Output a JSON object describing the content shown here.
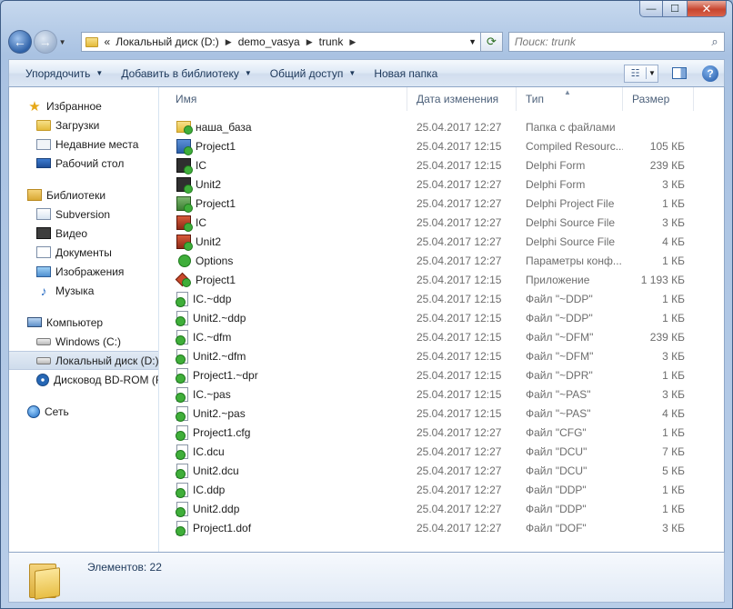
{
  "window": {
    "caption_min": "—",
    "caption_max": "☐",
    "caption_close": "✕"
  },
  "address": {
    "overflow": "«",
    "segments": [
      "Локальный диск (D:)",
      "demo_vasya",
      "trunk"
    ]
  },
  "search": {
    "placeholder": "Поиск: trunk"
  },
  "toolbar": {
    "organize": "Упорядочить",
    "add_library": "Добавить в библиотеку",
    "share": "Общий доступ",
    "new_folder": "Новая папка"
  },
  "nav": {
    "favorites": {
      "label": "Избранное",
      "items": [
        "Загрузки",
        "Недавние места",
        "Рабочий стол"
      ]
    },
    "libraries": {
      "label": "Библиотеки",
      "items": [
        "Subversion",
        "Видео",
        "Документы",
        "Изображения",
        "Музыка"
      ]
    },
    "computer": {
      "label": "Компьютер",
      "items": [
        "Windows (C:)",
        "Локальный диск (D:)",
        "Дисковод BD-ROM (F"
      ]
    },
    "network": {
      "label": "Сеть"
    }
  },
  "columns": {
    "name": "Имя",
    "date": "Дата изменения",
    "type": "Тип",
    "size": "Размер"
  },
  "files": [
    {
      "name": "наша_база",
      "date": "25.04.2017 12:27",
      "type": "Папка с файлами",
      "size": "",
      "icon": "folder-icon"
    },
    {
      "name": "Project1",
      "date": "25.04.2017 12:15",
      "type": "Compiled Resourc...",
      "size": "105 КБ",
      "icon": "resource-file-icon"
    },
    {
      "name": "IC",
      "date": "25.04.2017 12:15",
      "type": "Delphi Form",
      "size": "239 КБ",
      "icon": "delphi-form-icon"
    },
    {
      "name": "Unit2",
      "date": "25.04.2017 12:27",
      "type": "Delphi Form",
      "size": "3 КБ",
      "icon": "delphi-form-icon"
    },
    {
      "name": "Project1",
      "date": "25.04.2017 12:27",
      "type": "Delphi Project File",
      "size": "1 КБ",
      "icon": "delphi-project-icon"
    },
    {
      "name": "IC",
      "date": "25.04.2017 12:27",
      "type": "Delphi Source File",
      "size": "3 КБ",
      "icon": "delphi-source-icon"
    },
    {
      "name": "Unit2",
      "date": "25.04.2017 12:27",
      "type": "Delphi Source File",
      "size": "4 КБ",
      "icon": "delphi-source-icon"
    },
    {
      "name": "Options",
      "date": "25.04.2017 12:27",
      "type": "Параметры конф...",
      "size": "1 КБ",
      "icon": "options-file-icon"
    },
    {
      "name": "Project1",
      "date": "25.04.2017 12:15",
      "type": "Приложение",
      "size": "1 193 КБ",
      "icon": "application-icon"
    },
    {
      "name": "IC.~ddp",
      "date": "25.04.2017 12:15",
      "type": "Файл \"~DDP\"",
      "size": "1 КБ",
      "icon": "file-icon"
    },
    {
      "name": "Unit2.~ddp",
      "date": "25.04.2017 12:15",
      "type": "Файл \"~DDP\"",
      "size": "1 КБ",
      "icon": "file-icon"
    },
    {
      "name": "IC.~dfm",
      "date": "25.04.2017 12:15",
      "type": "Файл \"~DFM\"",
      "size": "239 КБ",
      "icon": "file-icon"
    },
    {
      "name": "Unit2.~dfm",
      "date": "25.04.2017 12:15",
      "type": "Файл \"~DFM\"",
      "size": "3 КБ",
      "icon": "file-icon"
    },
    {
      "name": "Project1.~dpr",
      "date": "25.04.2017 12:15",
      "type": "Файл \"~DPR\"",
      "size": "1 КБ",
      "icon": "file-icon"
    },
    {
      "name": "IC.~pas",
      "date": "25.04.2017 12:15",
      "type": "Файл \"~PAS\"",
      "size": "3 КБ",
      "icon": "file-icon"
    },
    {
      "name": "Unit2.~pas",
      "date": "25.04.2017 12:15",
      "type": "Файл \"~PAS\"",
      "size": "4 КБ",
      "icon": "file-icon"
    },
    {
      "name": "Project1.cfg",
      "date": "25.04.2017 12:27",
      "type": "Файл \"CFG\"",
      "size": "1 КБ",
      "icon": "file-icon"
    },
    {
      "name": "IC.dcu",
      "date": "25.04.2017 12:27",
      "type": "Файл \"DCU\"",
      "size": "7 КБ",
      "icon": "file-icon"
    },
    {
      "name": "Unit2.dcu",
      "date": "25.04.2017 12:27",
      "type": "Файл \"DCU\"",
      "size": "5 КБ",
      "icon": "file-icon"
    },
    {
      "name": "IC.ddp",
      "date": "25.04.2017 12:27",
      "type": "Файл \"DDP\"",
      "size": "1 КБ",
      "icon": "file-icon"
    },
    {
      "name": "Unit2.ddp",
      "date": "25.04.2017 12:27",
      "type": "Файл \"DDP\"",
      "size": "1 КБ",
      "icon": "file-icon"
    },
    {
      "name": "Project1.dof",
      "date": "25.04.2017 12:27",
      "type": "Файл \"DOF\"",
      "size": "3 КБ",
      "icon": "file-icon"
    }
  ],
  "status": {
    "count": "Элементов: 22"
  }
}
